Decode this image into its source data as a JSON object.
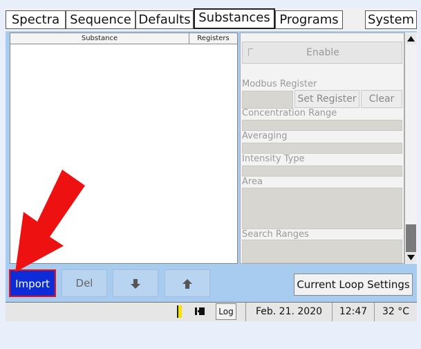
{
  "tabs": [
    {
      "label": "Spectra",
      "active": false
    },
    {
      "label": "Sequence",
      "active": false
    },
    {
      "label": "Defaults",
      "active": false
    },
    {
      "label": "Substances",
      "active": true
    },
    {
      "label": "Programs",
      "active": false
    },
    {
      "label": "System",
      "active": false
    }
  ],
  "substance_list": {
    "headers": [
      "Substance",
      "Registers"
    ],
    "rows": []
  },
  "properties": {
    "enable_label": "Enable",
    "enable_checked": false,
    "modbus_register_label": "Modbus Register",
    "set_register_label": "Set Register",
    "clear_label": "Clear",
    "concentration_range_label": "Concentration Range",
    "averaging_label": "Averaging",
    "intensity_type_label": "Intensity Type",
    "area_label": "Area",
    "search_ranges_label": "Search Ranges"
  },
  "actions": {
    "import_label": "Import",
    "del_label": "Del",
    "move_down_icon": "arrow-down-icon",
    "move_up_icon": "arrow-up-icon",
    "current_loop_label": "Current Loop Settings"
  },
  "status_bar": {
    "indicator_icon": "yellow-indicator-icon",
    "plug_icon": "plug-icon",
    "log_label": "Log",
    "date": "Feb. 21. 2020",
    "time": "12:47",
    "temperature": "32 °C"
  },
  "colors": {
    "panel_background": "#a8ccf0",
    "import_button": "#0d2bd6",
    "highlight_border": "#ee1111",
    "annotation_arrow": "#ee1111"
  }
}
